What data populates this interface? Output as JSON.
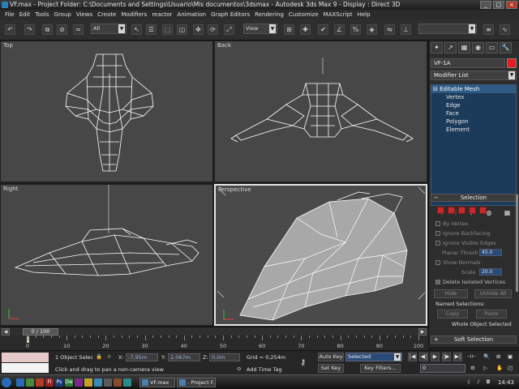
{
  "window": {
    "title": "VF.max    - Project Folder: C:\\Documents and Settings\\Usuario\\Mis documentos\\3dsmax    - Autodesk 3ds Max 9    - Display : Direct 3D",
    "controls": [
      "_",
      "□",
      "×"
    ]
  },
  "menu": [
    "File",
    "Edit",
    "Tools",
    "Group",
    "Views",
    "Create",
    "Modifiers",
    "reactor",
    "Animation",
    "Graph Editors",
    "Rendering",
    "Customize",
    "MAXScript",
    "Help"
  ],
  "toolbar": {
    "selection_filter": "All",
    "reference_coord": "View"
  },
  "viewports": {
    "top": "Top",
    "back": "Back",
    "right": "Right",
    "perspective": "Perspective"
  },
  "command_panel": {
    "tabs": [
      "✦",
      "↗",
      "▦",
      "◉",
      "▭",
      "🔧"
    ],
    "object_name": "VF-1A",
    "object_color": "#e81c1c",
    "modifier_list": "Modifier List",
    "stack_root": "Editable Mesh",
    "stack_items": [
      "Vertex",
      "Edge",
      "Face",
      "Polygon",
      "Element"
    ],
    "stack_buttons": [
      "⊣",
      "⫶",
      "∀",
      "◍",
      "▦"
    ],
    "selection_rollout": "Selection",
    "by_vertex": "By Vertex",
    "ignore_backfacing": "Ignore Backfacing",
    "ignore_visible_edges": "Ignore Visible Edges",
    "planar_thresh": "Planar Thresh",
    "planar_thresh_value": "45.0",
    "show_normals": "Show Normals",
    "scale": "Scale",
    "scale_value": "20.0",
    "delete_isolated": "Delete Isolated Vertices",
    "hide": "Hide",
    "unhide_all": "Unhide All",
    "named_selections": "Named Selections:",
    "copy": "Copy",
    "paste": "Paste",
    "whole_object": "Whole Object Selected",
    "soft_selection": "Soft Selection"
  },
  "timeline": {
    "frame_display": "0 / 100",
    "ticks": [
      "0",
      "10",
      "20",
      "30",
      "40",
      "50",
      "60",
      "70",
      "80",
      "90",
      "100"
    ]
  },
  "status": {
    "selection_count": "1 Object Selec",
    "x_label": "X:",
    "x_value": "-7,95m",
    "y_label": "Y:",
    "y_value": "2,067m",
    "z_label": "Z:",
    "z_value": "0,0m",
    "grid": "Grid = 0,254m",
    "prompt": "Click and drag to pan a non-camera view",
    "add_time_tag": "Add Time Tag",
    "auto_key": "Auto Key",
    "set_key": "Set Key",
    "key_filters": "Key Filters...",
    "key_mode": "Selected",
    "current_frame": "0",
    "playback": [
      "|◀",
      "◀|",
      "▶",
      "|▶",
      "▶|"
    ]
  },
  "taskbar": {
    "tasks": [
      "VF.max",
      "- Project F..."
    ],
    "quicklaunch": [
      "Fl",
      "Ps",
      "Dw"
    ],
    "clock": "14:43"
  }
}
